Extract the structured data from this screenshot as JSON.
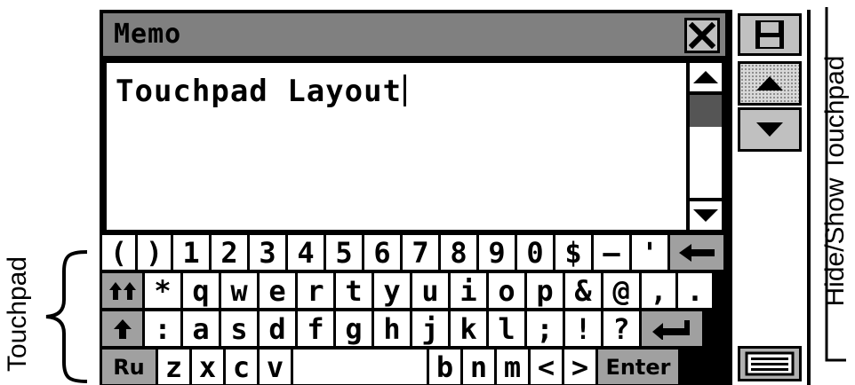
{
  "window": {
    "title": "Memo",
    "close_icon": "close-icon"
  },
  "memo": {
    "text": "Touchpad Layout"
  },
  "side_panel": {
    "save_icon": "floppy-disk-icon",
    "page_up_icon": "triangle-up-icon",
    "page_down_icon": "triangle-down-icon",
    "keyboard_icon": "keyboard-icon"
  },
  "keyboard": {
    "rows": [
      [
        {
          "label": "(",
          "gray": false
        },
        {
          "label": ")",
          "gray": false
        },
        {
          "label": "1",
          "gray": false
        },
        {
          "label": "2",
          "gray": false
        },
        {
          "label": "3",
          "gray": false
        },
        {
          "label": "4",
          "gray": false
        },
        {
          "label": "5",
          "gray": false
        },
        {
          "label": "6",
          "gray": false
        },
        {
          "label": "7",
          "gray": false
        },
        {
          "label": "8",
          "gray": false
        },
        {
          "label": "9",
          "gray": false
        },
        {
          "label": "0",
          "gray": false
        },
        {
          "label": "$",
          "gray": false
        },
        {
          "label": "–",
          "gray": false
        },
        {
          "label": "'",
          "gray": false
        },
        {
          "label": "",
          "icon": "backspace-arrow-icon",
          "gray": true
        }
      ],
      [
        {
          "label": "",
          "icon": "caps-lock-icon",
          "gray": true
        },
        {
          "label": "*",
          "gray": false
        },
        {
          "label": "q",
          "gray": false
        },
        {
          "label": "w",
          "gray": false
        },
        {
          "label": "e",
          "gray": false
        },
        {
          "label": "r",
          "gray": false
        },
        {
          "label": "t",
          "gray": false
        },
        {
          "label": "y",
          "gray": false
        },
        {
          "label": "u",
          "gray": false
        },
        {
          "label": "i",
          "gray": false
        },
        {
          "label": "o",
          "gray": false
        },
        {
          "label": "p",
          "gray": false
        },
        {
          "label": "&",
          "gray": false
        },
        {
          "label": "@",
          "gray": false
        },
        {
          "label": ",",
          "gray": false
        },
        {
          "label": ".",
          "gray": false
        }
      ],
      [
        {
          "label": "",
          "icon": "shift-arrow-icon",
          "gray": true
        },
        {
          "label": ":",
          "gray": false
        },
        {
          "label": "a",
          "gray": false
        },
        {
          "label": "s",
          "gray": false
        },
        {
          "label": "d",
          "gray": false
        },
        {
          "label": "f",
          "gray": false
        },
        {
          "label": "g",
          "gray": false
        },
        {
          "label": "h",
          "gray": false
        },
        {
          "label": "j",
          "gray": false
        },
        {
          "label": "k",
          "gray": false
        },
        {
          "label": "l",
          "gray": false
        },
        {
          "label": ";",
          "gray": false
        },
        {
          "label": "!",
          "gray": false
        },
        {
          "label": "?",
          "gray": false
        },
        {
          "label": "",
          "icon": "return-arrow-icon",
          "gray": true
        }
      ],
      [
        {
          "label": "Ru",
          "gray": true
        },
        {
          "label": "z",
          "gray": false
        },
        {
          "label": "x",
          "gray": false
        },
        {
          "label": "c",
          "gray": false
        },
        {
          "label": "v",
          "gray": false
        },
        {
          "label": "",
          "gray": false
        },
        {
          "label": "b",
          "gray": false
        },
        {
          "label": "n",
          "gray": false
        },
        {
          "label": "m",
          "gray": false
        },
        {
          "label": "<",
          "gray": false
        },
        {
          "label": ">",
          "gray": false
        },
        {
          "label": "Enter",
          "gray": true
        }
      ]
    ]
  },
  "annotations": {
    "touchpad_label": "Touchpad",
    "hideshow_label": "Hide/Show Touchpad"
  }
}
